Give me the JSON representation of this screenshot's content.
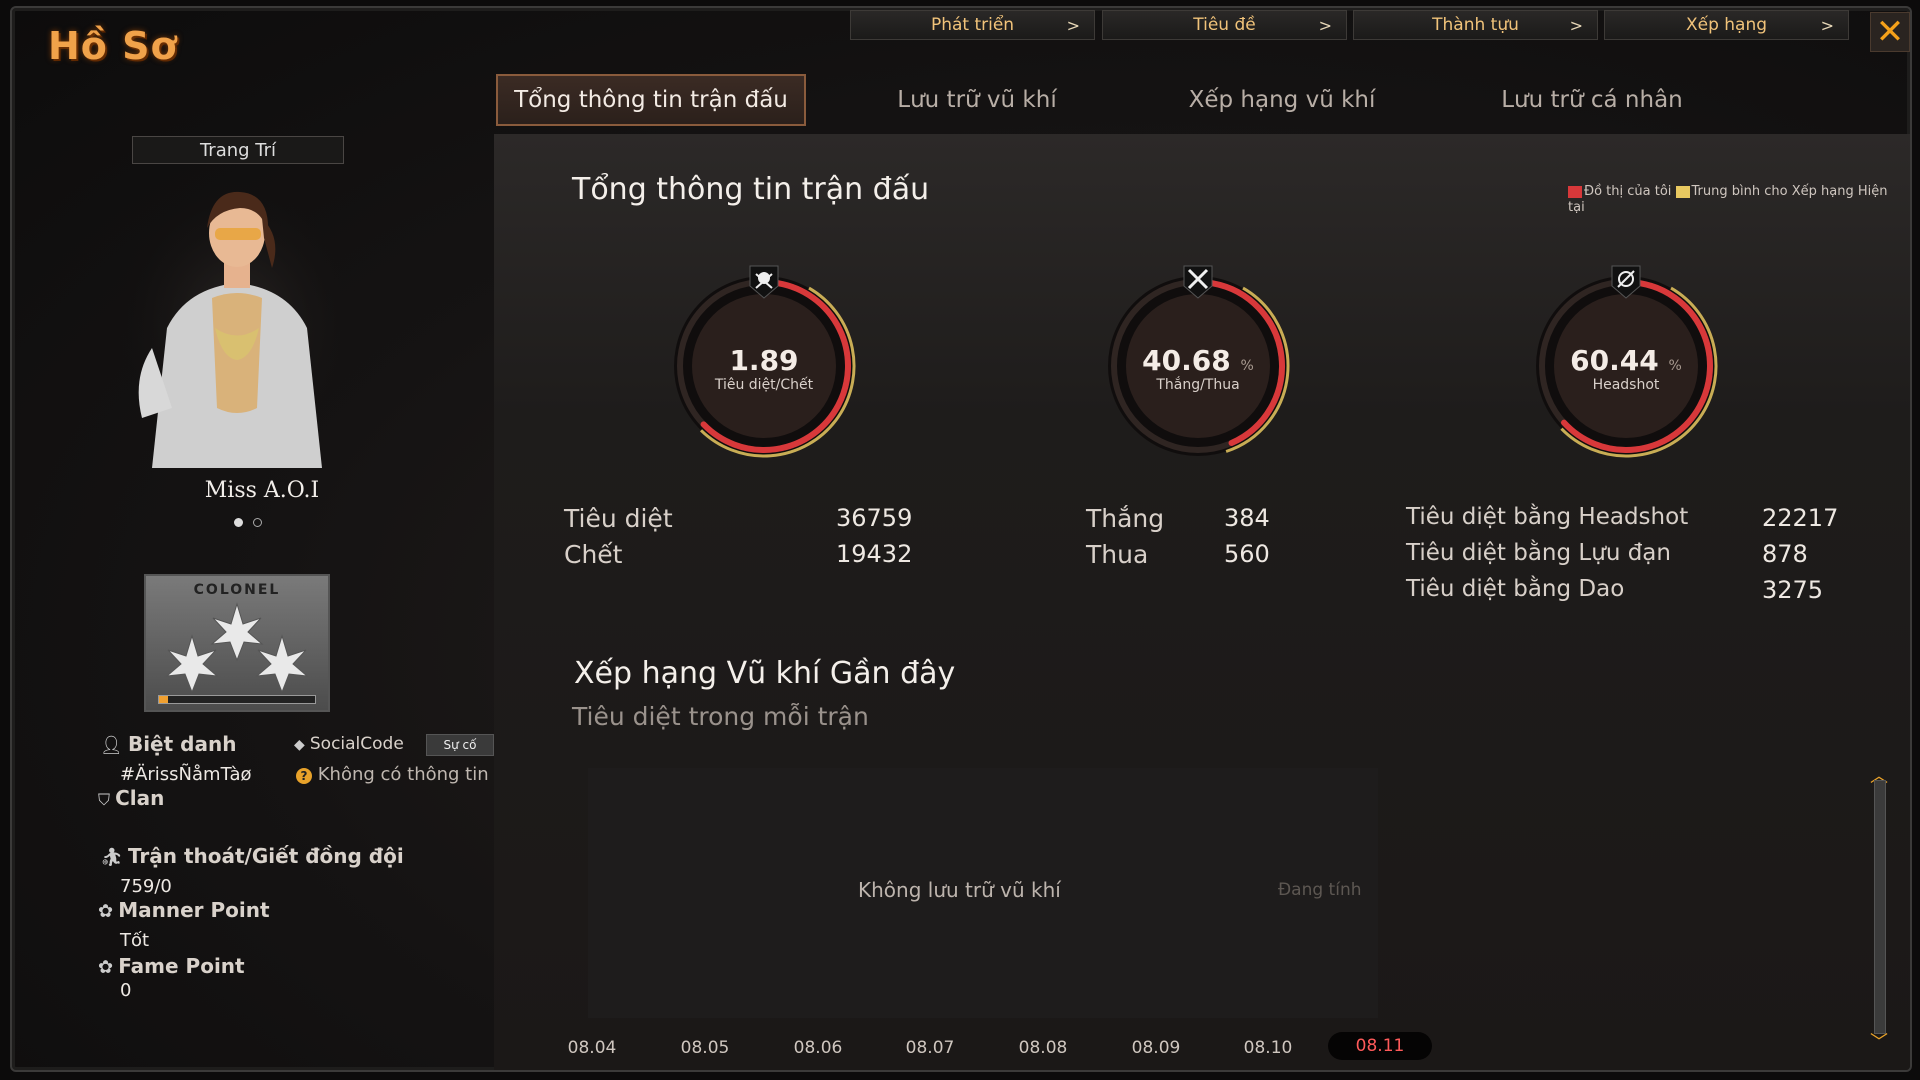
{
  "app": {
    "title": "Hồ Sơ"
  },
  "top_nav": [
    {
      "label": "Phát triển"
    },
    {
      "label": "Tiêu đề"
    },
    {
      "label": "Thành tựu"
    },
    {
      "label": "Xếp hạng"
    }
  ],
  "tabs": [
    {
      "label": "Tổng thông tin trận đấu",
      "active": true
    },
    {
      "label": "Lưu trữ vũ khí",
      "active": false
    },
    {
      "label": "Xếp hạng vũ khí",
      "active": false
    },
    {
      "label": "Lưu trữ cá nhân",
      "active": false
    }
  ],
  "profile": {
    "decorate_label": "Trang Trí",
    "character_name": "Miss A.O.I",
    "rank_title": "COLONEL",
    "rank_progress": 0.06,
    "nickname_label": "Biệt danh",
    "nickname_value": "#ÄrissÑåmTàø",
    "socialcode_label": "SocialCode",
    "socialcode_button": "Sự cố",
    "socialcode_value": "Không có thông tin",
    "clan_label": "Clan",
    "escape_label": "Trận thoát/Giết đồng đội",
    "escape_value": "759/0",
    "manner_label": "Manner Point",
    "manner_value": "Tốt",
    "fame_label": "Fame Point",
    "fame_value": "0"
  },
  "summary": {
    "title": "Tổng thông tin trận đấu",
    "legend_mine": "Đồ thị của tôi",
    "legend_avg": "Trung bình cho Xếp hạng Hiện tại",
    "colors": {
      "mine": "#d8383a",
      "avg": "#e8c860",
      "accent": "#f0a24a"
    },
    "gauges": [
      {
        "value": "1.89",
        "unit": "",
        "label": "Tiêu diệt/Chết",
        "icon": "skull-crossbones-icon",
        "fill": 0.6
      },
      {
        "value": "40.68",
        "unit": "%",
        "label": "Thắng/Thua",
        "icon": "crossed-swords-icon",
        "fill": 0.4068
      },
      {
        "value": "60.44",
        "unit": "%",
        "label": "Headshot",
        "icon": "crosshair-icon",
        "fill": 0.6044
      }
    ],
    "stats_left": [
      {
        "label": "Tiêu diệt",
        "value": "36759"
      },
      {
        "label": "Chết",
        "value": "19432"
      }
    ],
    "stats_mid": [
      {
        "label": "Thắng",
        "value": "384"
      },
      {
        "label": "Thua",
        "value": "560"
      }
    ],
    "stats_right": [
      {
        "label": "Tiêu diệt bằng Headshot",
        "value": "22217"
      },
      {
        "label": "Tiêu diệt bằng Lựu đạn",
        "value": "878"
      },
      {
        "label": "Tiêu diệt bằng Dao",
        "value": "3275"
      }
    ]
  },
  "weapon_ranking": {
    "title": "Xếp hạng Vũ khí Gần đây",
    "subtitle": "Tiêu diệt trong mỗi trận",
    "empty_message": "Không lưu trữ vũ khí",
    "status": "Đang tính",
    "dates": [
      "08.04",
      "08.05",
      "08.06",
      "08.07",
      "08.08",
      "08.09",
      "08.10",
      "08.11"
    ],
    "selected_date": "08.11"
  }
}
